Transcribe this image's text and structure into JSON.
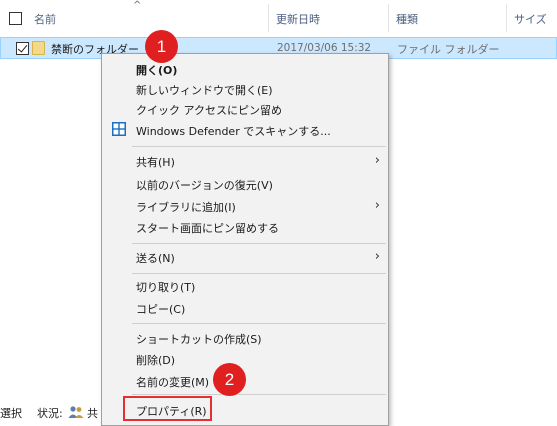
{
  "columns": {
    "name": "名前",
    "modified": "更新日時",
    "type": "種類",
    "size": "サイズ"
  },
  "sort_indicator": "^",
  "file": {
    "name": "禁断のフォルダー",
    "modified": "2017/03/06 15:32",
    "type": "ファイル フォルダー",
    "icon": "folder-icon",
    "checked": true
  },
  "status": {
    "left": "選択",
    "state_label": "状況:",
    "share_text": "共"
  },
  "menu": {
    "open": "開く(O)",
    "open_new_window": "新しいウィンドウで開く(E)",
    "pin_quick_access": "クイック アクセスにピン留め",
    "defender_scan": "Windows Defender でスキャンする...",
    "share": "共有(H)",
    "restore_previous": "以前のバージョンの復元(V)",
    "add_to_library": "ライブラリに追加(I)",
    "pin_start": "スタート画面にピン留めする",
    "send_to": "送る(N)",
    "cut": "切り取り(T)",
    "copy": "コピー(C)",
    "create_shortcut": "ショートカットの作成(S)",
    "delete": "削除(D)",
    "rename": "名前の変更(M)",
    "properties": "プロパティ(R)",
    "submenu_arrow": "›"
  },
  "annotations": {
    "step1": "1",
    "step2": "2",
    "color": "#e02020"
  },
  "colors": {
    "selection": "#cce8ff",
    "menu_bg": "#f2f2f2",
    "defender_blue": "#1a6fc4"
  }
}
